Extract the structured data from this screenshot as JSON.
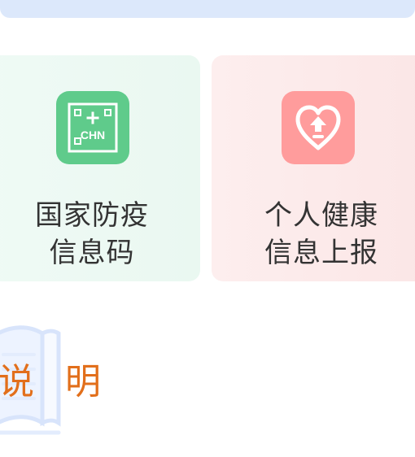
{
  "cards": [
    {
      "icon": "chn-code-icon",
      "line1": "国家防疫",
      "line2": "信息码",
      "icon_text": "CHN",
      "accent": "#5fcb8b",
      "bg": "#eaf8f1"
    },
    {
      "icon": "health-heart-upload-icon",
      "line1": "个人健康",
      "line2": "信息上报",
      "accent": "#ff9c9c",
      "bg": "#fbe6e6"
    }
  ],
  "section": {
    "title_char_1": "说",
    "title_char_2": "明",
    "icon": "book-icon",
    "title_color": "#e26f1b"
  },
  "colors": {
    "top_strip": "#dce8fb",
    "text": "#333333"
  }
}
